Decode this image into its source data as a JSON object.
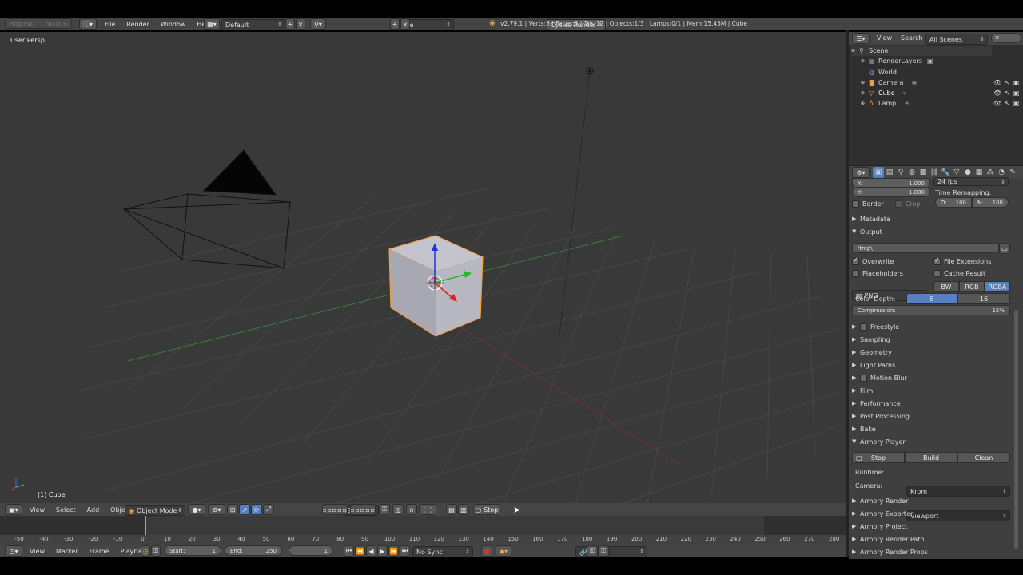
{
  "topbar": {
    "progress_label": "Progress",
    "progress_value": "50.00%",
    "menus": [
      "File",
      "Render",
      "Window",
      "Help"
    ],
    "layout": "Default",
    "scene": "Scene",
    "engine": "Cycles Render",
    "stats": "v2.79.1 | Verts:8 | Faces:6 | Tris:12 | Objects:1/3 | Lamps:0/1 | Mem:15.45M | Cube"
  },
  "viewport": {
    "view_label": "User Persp",
    "object_label": "(1) Cube"
  },
  "view_header": {
    "menus": [
      "View",
      "Select",
      "Add",
      "Object"
    ],
    "mode": "Object Mode",
    "orientation": "Global",
    "stop_label": "Stop"
  },
  "timeline": {
    "ticks": [
      "-50",
      "-40",
      "-30",
      "-20",
      "-10",
      "0",
      "10",
      "20",
      "30",
      "40",
      "50",
      "60",
      "70",
      "80",
      "90",
      "100",
      "110",
      "120",
      "130",
      "140",
      "150",
      "160",
      "170",
      "180",
      "190",
      "200",
      "210",
      "220",
      "230",
      "240",
      "250",
      "260",
      "270",
      "280"
    ],
    "menus": [
      "View",
      "Marker",
      "Frame",
      "Playback"
    ],
    "start": "Start:",
    "start_val": "1",
    "end": "End:",
    "end_val": "250",
    "current": "1",
    "sync": "No Sync"
  },
  "outliner": {
    "view": "View",
    "search": "Search",
    "filter": "All Scenes",
    "items": [
      "Scene",
      "RenderLayers",
      "World",
      "Camera",
      "Cube",
      "Lamp"
    ]
  },
  "props": {
    "x_label": "X:",
    "x_val": "1.000",
    "y_label": "Y:",
    "y_val": "1.000",
    "fps": "24 fps",
    "time_remap": "Time Remapping:",
    "old_label": "O:",
    "old_val": "100",
    "new_label": "N:",
    "new_val": "100",
    "border": "Border",
    "crop": "Crop",
    "metadata": "Metadata",
    "output": "Output",
    "path": "/tmp\\",
    "overwrite": "Overwrite",
    "file_ext": "File Extensions",
    "placeholders": "Placeholders",
    "cache_result": "Cache Result",
    "format": "PNG",
    "bw": "BW",
    "rgb": "RGB",
    "rgba": "RGBA",
    "color_depth": "Color Depth:",
    "depth8": "8",
    "depth16": "16",
    "compression": "Compression:",
    "compression_val": "15%",
    "panels": [
      "Freestyle",
      "Sampling",
      "Geometry",
      "Light Paths",
      "Motion Blur",
      "Film",
      "Performance",
      "Post Processing",
      "Bake"
    ],
    "armory_player": "Armory Player",
    "stop": "Stop",
    "build": "Build",
    "clean": "Clean",
    "runtime_label": "Runtime:",
    "runtime": "Krom",
    "camera_label": "Camera:",
    "camera": "Viewport",
    "armory_panels": [
      "Armory Render",
      "Armory Exporter",
      "Armory Project",
      "Armory Render Path",
      "Armory Render Props"
    ]
  },
  "colors": {
    "accent_blue": "#5680c2",
    "selection_orange": "#f0a040"
  }
}
